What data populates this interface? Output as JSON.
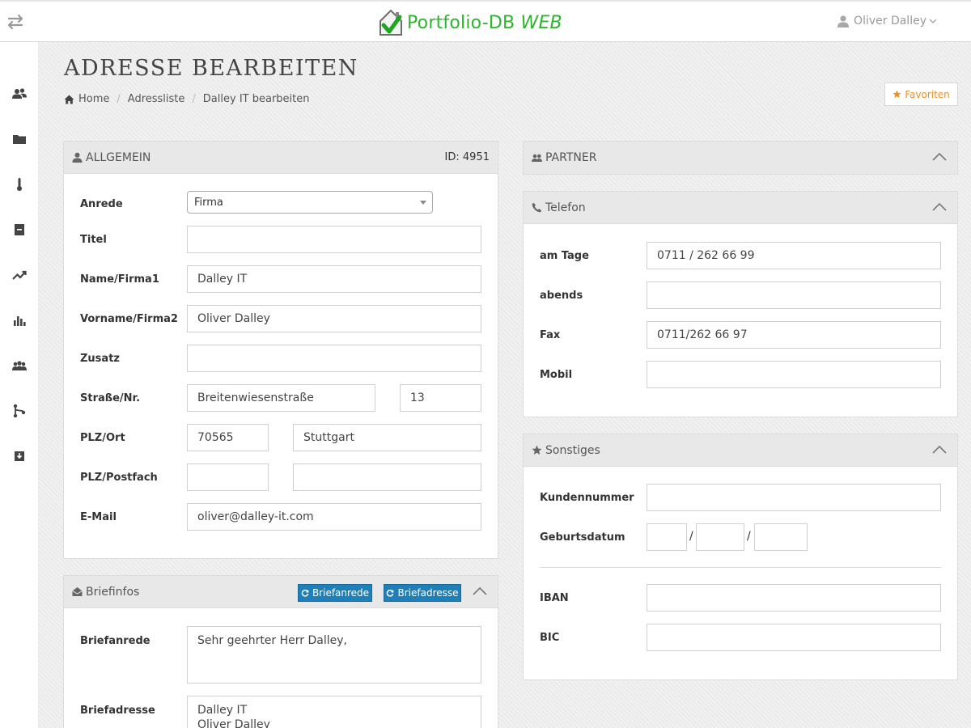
{
  "app": {
    "name": "Portfolio-DB",
    "name_suffix": "WEB",
    "user": "Oliver Dalley"
  },
  "sidebar": {
    "icons": [
      "users-icon",
      "folder-icon",
      "thermometer-icon",
      "book-icon",
      "trending-up-icon",
      "bar-chart-icon",
      "group-icon",
      "branch-icon",
      "download-icon"
    ]
  },
  "page": {
    "title": "ADRESSE BEARBEITEN",
    "favorites_label": "Favoriten"
  },
  "breadcrumb": [
    "Home",
    "Adressliste",
    "Dalley IT bearbeiten"
  ],
  "allgemein": {
    "title": "ALLGEMEIN",
    "id_label": "ID: 4951",
    "fields": {
      "anrede": {
        "label": "Anrede",
        "value": "Firma"
      },
      "titel": {
        "label": "Titel",
        "value": ""
      },
      "name": {
        "label": "Name/Firma1",
        "value": "Dalley IT"
      },
      "vorname": {
        "label": "Vorname/Firma2",
        "value": "Oliver Dalley"
      },
      "zusatz": {
        "label": "Zusatz",
        "value": ""
      },
      "strasse": {
        "label": "Straße/Nr.",
        "value": "Breitenwiesenstraße",
        "nr": "13"
      },
      "plz_ort": {
        "label": "PLZ/Ort",
        "plz": "70565",
        "ort": "Stuttgart"
      },
      "plz_postfach": {
        "label": "PLZ/Postfach",
        "plz": "",
        "postfach": ""
      },
      "email": {
        "label": "E-Mail",
        "value": "oliver@dalley-it.com"
      }
    }
  },
  "briefinfos": {
    "title": "Briefinfos",
    "btn_briefanrede": "Briefanrede",
    "btn_briefadresse": "Briefadresse",
    "briefanrede": {
      "label": "Briefanrede",
      "value": "Sehr geehrter Herr Dalley,"
    },
    "briefadresse": {
      "label": "Briefadresse",
      "value": "Dalley IT\nOliver Dalley"
    }
  },
  "partner": {
    "title": "PARTNER"
  },
  "telefon": {
    "title": "Telefon",
    "fields": {
      "am_tage": {
        "label": "am Tage",
        "value": "0711 / 262 66 99"
      },
      "abends": {
        "label": "abends",
        "value": ""
      },
      "fax": {
        "label": "Fax",
        "value": "0711/262 66 97"
      },
      "mobil": {
        "label": "Mobil",
        "value": ""
      }
    }
  },
  "sonstiges": {
    "title": "Sonstiges",
    "fields": {
      "kundennummer": {
        "label": "Kundennummer",
        "value": ""
      },
      "geburtsdatum": {
        "label": "Geburtsdatum",
        "day": "",
        "month": "",
        "year": "",
        "separator": "/"
      },
      "iban": {
        "label": "IBAN",
        "value": ""
      },
      "bic": {
        "label": "BIC",
        "value": ""
      }
    }
  },
  "colors": {
    "brand_green": "#2db52d",
    "favorites_orange": "#e8912d",
    "button_blue": "#1f7fb8"
  }
}
